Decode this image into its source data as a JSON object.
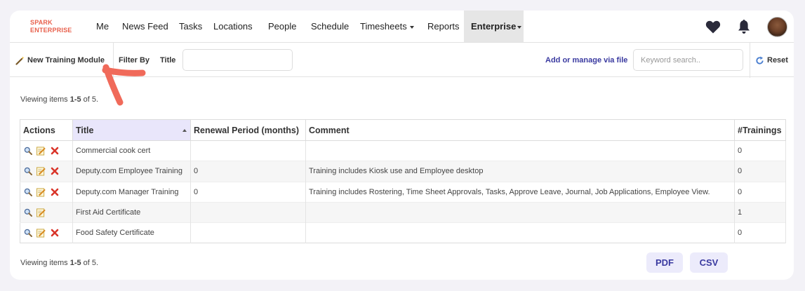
{
  "brand": {
    "line1": "SPARK",
    "line2": "ENTERPRISE",
    "color": "#e8604c"
  },
  "nav": {
    "items": [
      {
        "label": "Me"
      },
      {
        "label": "News Feed"
      },
      {
        "label": "Tasks"
      },
      {
        "label": "Locations"
      },
      {
        "label": "People"
      },
      {
        "label": "Schedule"
      },
      {
        "label": "Timesheets"
      },
      {
        "label": "Reports"
      },
      {
        "label": "Enterprise"
      }
    ],
    "icons": [
      "heart-icon",
      "bell-icon",
      "avatar"
    ]
  },
  "toolbar": {
    "new_label": "New Training Module",
    "filter_label": "Filter By",
    "title_label": "Title",
    "title_value": "",
    "manage_link": "Add or manage via file",
    "search_placeholder": "Keyword search..",
    "reset_label": "Reset"
  },
  "viewing_top": {
    "prefix": "Viewing items ",
    "range": "1-5",
    "of": " of ",
    "total": "5",
    "suffix": "."
  },
  "viewing_bottom": {
    "prefix": "Viewing items ",
    "range": "1-5",
    "of": " of ",
    "total": "5",
    "suffix": "."
  },
  "table": {
    "headers": [
      "Actions",
      "Title",
      "Renewal Period (months)",
      "Comment",
      "#Trainings"
    ],
    "sorted_column": "Title",
    "rows": [
      {
        "title": "Commercial cook cert",
        "renewal": "",
        "comment": "",
        "trainings": "0",
        "deletable": true
      },
      {
        "title": "Deputy.com Employee Training",
        "renewal": "0",
        "comment": "Training includes Kiosk use and Employee desktop",
        "trainings": "0",
        "deletable": true
      },
      {
        "title": "Deputy.com Manager Training",
        "renewal": "0",
        "comment": "Training includes Rostering, Time Sheet Approvals, Tasks, Approve Leave, Journal, Job Applications, Employee View.",
        "trainings": "0",
        "deletable": true
      },
      {
        "title": "First Aid Certificate",
        "renewal": "",
        "comment": "",
        "trainings": "1",
        "deletable": false
      },
      {
        "title": "Food Safety Certificate",
        "renewal": "",
        "comment": "",
        "trainings": "0",
        "deletable": true
      }
    ]
  },
  "export": {
    "pdf": "PDF",
    "csv": "CSV"
  },
  "colors": {
    "accent": "#3a3aa0",
    "annotation": "#f06a5a",
    "active_tab": "#e6e6e6",
    "sorted_header": "#e9e6fb"
  }
}
